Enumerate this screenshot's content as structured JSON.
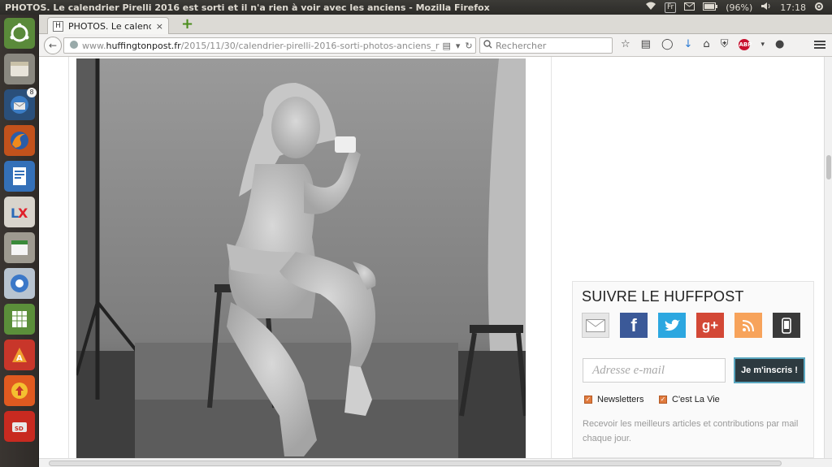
{
  "window": {
    "title": "PHOTOS. Le calendrier Pirelli 2016 est sorti et il n'a rien à voir avec les anciens - Mozilla Firefox"
  },
  "tray": {
    "keyboard": "Fr",
    "battery": "(96%)",
    "time": "17:18"
  },
  "launcher": {
    "thunderbird_badge": "8"
  },
  "tab": {
    "label": "PHOTOS. Le calendr...",
    "close": "×",
    "favicon": "H",
    "new_tab": "+"
  },
  "url": {
    "prefix": "www.",
    "domain": "huffingtonpost.fr",
    "path": "/2015/11/30/calendrier-pirelli-2016-sorti-photos-anciens_r"
  },
  "search": {
    "placeholder": "Rechercher"
  },
  "follow": {
    "title": "SUIVRE LE HUFFPOST",
    "social": [
      "email-icon",
      "facebook-icon",
      "twitter-icon",
      "google-plus-icon",
      "rss-icon",
      "mobile-icon"
    ],
    "social_colors": [
      "#e6e6e6",
      "#3b5998",
      "#2ca7e0",
      "#d34836",
      "#f7a35b",
      "#3a3a3a"
    ],
    "email_placeholder": "Adresse e-mail",
    "subscribe_label": "Je m'inscris !",
    "checkbox1": "Newsletters",
    "checkbox2": "C'est La Vie",
    "description": "Recevoir les meilleurs articles et contributions par mail chaque jour."
  }
}
